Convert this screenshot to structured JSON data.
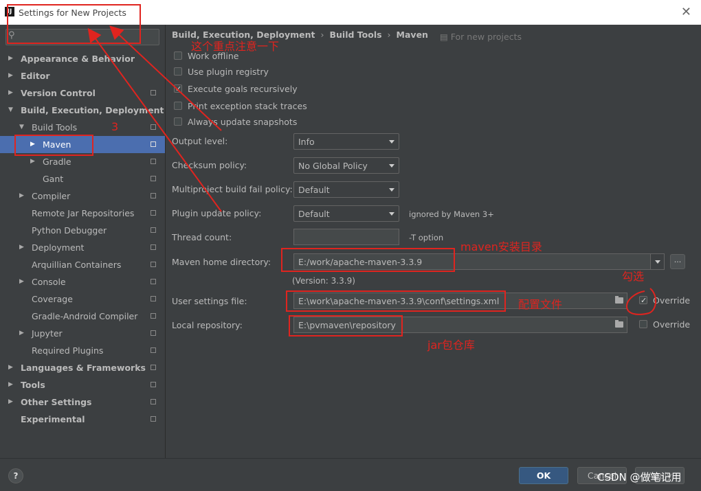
{
  "window": {
    "app_icon_text": "IJ",
    "title": "Settings for New Projects",
    "close_glyph": "✕"
  },
  "sidebar": {
    "search_placeholder": "",
    "items": [
      {
        "label": "Appearance & Behavior",
        "expanded": false
      },
      {
        "label": "Editor",
        "expanded": false
      },
      {
        "label": "Version Control",
        "expanded": false
      },
      {
        "label": "Build, Execution, Deployment",
        "expanded": true
      },
      {
        "label": "Build Tools",
        "expanded": true
      },
      {
        "label": "Maven",
        "expanded": false,
        "selected": true
      },
      {
        "label": "Gradle",
        "expanded": false
      },
      {
        "label": "Gant"
      },
      {
        "label": "Compiler",
        "expanded": false
      },
      {
        "label": "Remote Jar Repositories"
      },
      {
        "label": "Python Debugger"
      },
      {
        "label": "Deployment",
        "expanded": false
      },
      {
        "label": "Arquillian Containers"
      },
      {
        "label": "Console",
        "expanded": false
      },
      {
        "label": "Coverage"
      },
      {
        "label": "Gradle-Android Compiler"
      },
      {
        "label": "Jupyter",
        "expanded": false
      },
      {
        "label": "Required Plugins"
      },
      {
        "label": "Languages & Frameworks",
        "expanded": false
      },
      {
        "label": "Tools",
        "expanded": false
      },
      {
        "label": "Other Settings",
        "expanded": false
      },
      {
        "label": "Experimental"
      }
    ]
  },
  "breadcrumb": {
    "items": [
      "Build, Execution, Deployment",
      "Build Tools",
      "Maven"
    ],
    "separator": "›",
    "for_new_projects": "▤ For new projects"
  },
  "options": {
    "work_offline": {
      "label": "Work offline",
      "checked": false
    },
    "use_plugin_registry": {
      "label": "Use plugin registry",
      "checked": false
    },
    "execute_goals_recursively": {
      "label": "Execute goals recursively",
      "checked": true
    },
    "print_exception_stack_traces": {
      "label": "Print exception stack traces",
      "checked": false
    },
    "always_update_snapshots": {
      "label": "Always update snapshots",
      "checked": false
    }
  },
  "fields": {
    "output_level": {
      "label": "Output level:",
      "value": "Info"
    },
    "checksum_policy": {
      "label": "Checksum policy:",
      "value": "No Global Policy"
    },
    "multiproject_fail_policy": {
      "label": "Multiproject build fail policy:",
      "value": "Default"
    },
    "plugin_update_policy": {
      "label": "Plugin update policy:",
      "value": "Default",
      "hint": "ignored by Maven 3+"
    },
    "thread_count": {
      "label": "Thread count:",
      "value": "",
      "hint": "-T option"
    },
    "maven_home": {
      "label": "Maven home directory:",
      "value": "E:/work/apache-maven-3.3.9",
      "version": "(Version: 3.3.9)",
      "browse": "..."
    },
    "user_settings_file": {
      "label": "User settings file:",
      "value": "E:\\work\\apache-maven-3.3.9\\conf\\settings.xml",
      "override_label": "Override",
      "override_checked": true
    },
    "local_repository": {
      "label": "Local repository:",
      "value": "E:\\pvmaven\\repository",
      "override_label": "Override",
      "override_checked": false
    }
  },
  "footer": {
    "help": "?",
    "ok": "OK",
    "cancel": "Cancel",
    "apply": "Apply"
  },
  "annotations": {
    "note_top": "这个重点注意一下",
    "note_3": "3",
    "note_maven_home": "maven安装目录",
    "note_check": "勾选",
    "note_settings": "配置文件",
    "note_jar": "jar包仓库",
    "color": "#e0241f"
  },
  "watermark": "CSDN @做笔记用"
}
